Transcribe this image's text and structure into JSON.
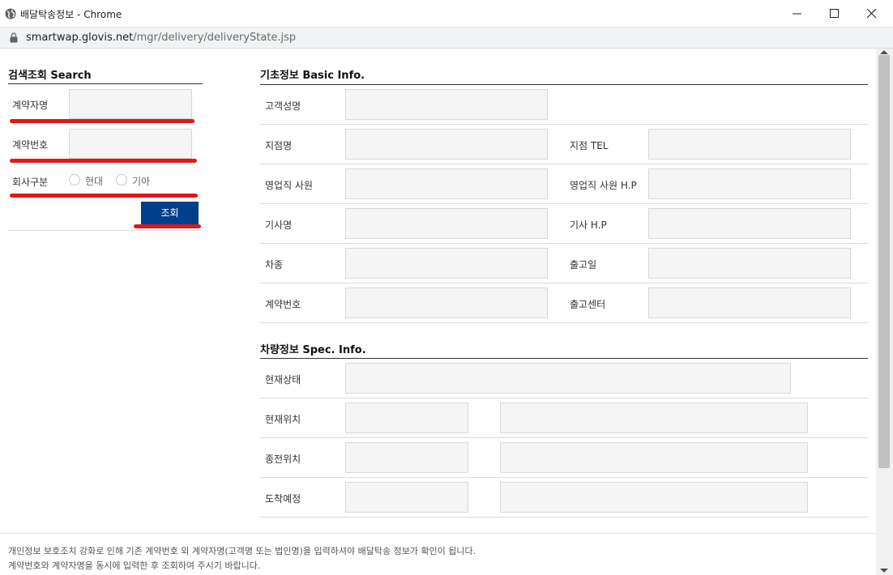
{
  "window": {
    "title": "배달탁송정보 - Chrome",
    "url_host": "smartwap.glovis.net",
    "url_path": "/mgr/delivery/deliveryState.jsp"
  },
  "search": {
    "title": "검색조회 Search",
    "contract_name_label": "계약자명",
    "contract_name_value": "",
    "contract_no_label": "계약번호",
    "contract_no_value": "",
    "company_label": "회사구분",
    "company_options": [
      "현대",
      "기아"
    ],
    "search_button": "조회"
  },
  "basic": {
    "title": "기초정보 Basic Info.",
    "customer_name": "고객성명",
    "branch_name": "지점명",
    "branch_tel": "지점 TEL",
    "sales_staff": "영업직 사원",
    "sales_staff_hp": "영업직 사원 H.P",
    "driver_name": "기사명",
    "driver_hp": "기사 H.P",
    "car_model": "차종",
    "release_date": "출고일",
    "contract_no": "계약번호",
    "release_center": "출고센터"
  },
  "spec": {
    "title": "차량정보 Spec. Info.",
    "current_status": "현재상태",
    "current_location": "현재위치",
    "previous_location": "종전위치",
    "arrival_eta": "도착예정"
  },
  "notice": {
    "line1": "개인정보 보호조치 강화로 인해 기존 계약번호 외 계약자명(고객명 또는 법인명)을 입력하셔야 배달탁송 정보가 확인이 됩니다.",
    "line2": "계약번호와 계약자명을 동시에 입력한 후 조회하여 주시기 바랍니다."
  },
  "colors": {
    "accent_button": "#003f8a",
    "annotation_red": "#e01818",
    "field_bg": "#f5f5f5"
  }
}
